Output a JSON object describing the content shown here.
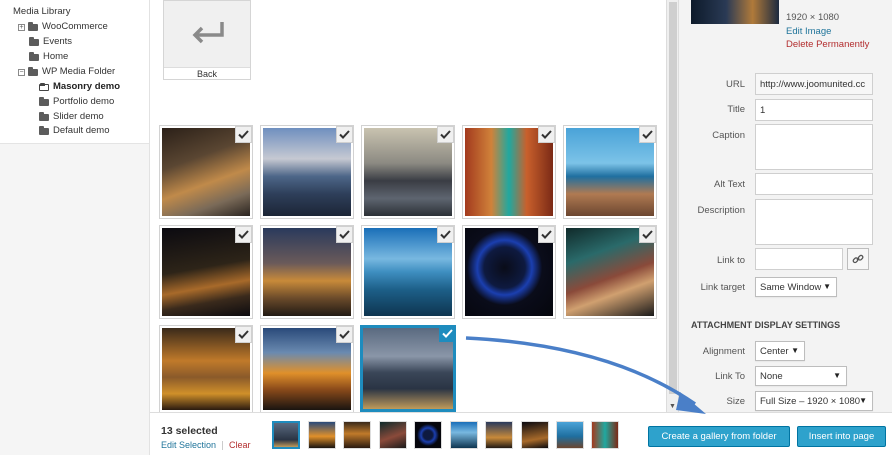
{
  "sidebar": {
    "items": [
      {
        "label": "Media Library",
        "level": 0,
        "expander": "",
        "icon": "none"
      },
      {
        "label": "WooCommerce",
        "level": 1,
        "expander": "+",
        "icon": "folder"
      },
      {
        "label": "Events",
        "level": 1,
        "expander": "",
        "icon": "folder"
      },
      {
        "label": "Home",
        "level": 1,
        "expander": "",
        "icon": "folder"
      },
      {
        "label": "WP Media Folder",
        "level": 1,
        "expander": "−",
        "icon": "folder"
      },
      {
        "label": "Masonry demo",
        "level": 2,
        "expander": "",
        "icon": "folder-open",
        "active": true
      },
      {
        "label": "Portfolio demo",
        "level": 2,
        "expander": "",
        "icon": "folder"
      },
      {
        "label": "Slider demo",
        "level": 2,
        "expander": "",
        "icon": "folder"
      },
      {
        "label": "Default demo",
        "level": 2,
        "expander": "",
        "icon": "folder"
      }
    ]
  },
  "grid": {
    "back_label": "Back",
    "back_icon": "return-arrow-icon",
    "thumbs": [
      {
        "name": "night-street",
        "checked": true
      },
      {
        "name": "city-skyline",
        "checked": true
      },
      {
        "name": "london-bridge",
        "checked": true
      },
      {
        "name": "venice-canal",
        "checked": true
      },
      {
        "name": "wooden-pier",
        "checked": true
      },
      {
        "name": "night-coast",
        "checked": true
      },
      {
        "name": "paris-night",
        "checked": true
      },
      {
        "name": "lake-pier",
        "checked": true
      },
      {
        "name": "ferris-wheel",
        "checked": true
      },
      {
        "name": "street-bokeh",
        "checked": true
      },
      {
        "name": "city-lights",
        "checked": true
      },
      {
        "name": "sunset-skyline",
        "checked": true
      },
      {
        "name": "brooklyn-bridge",
        "checked": true,
        "selected": true
      }
    ]
  },
  "details": {
    "dimensions": "1920 × 1080",
    "edit_image": "Edit Image",
    "delete_permanently": "Delete Permanently",
    "fields": {
      "url_label": "URL",
      "url_value": "http://www.joomunited.cc",
      "title_label": "Title",
      "title_value": "1",
      "caption_label": "Caption",
      "alt_label": "Alt Text",
      "description_label": "Description",
      "link_to_label": "Link to",
      "link_target_label": "Link target",
      "link_target_value": "Same Window"
    },
    "display_settings": {
      "heading": "ATTACHMENT DISPLAY SETTINGS",
      "alignment_label": "Alignment",
      "alignment_value": "Center",
      "link_to_label": "Link To",
      "link_to_value": "None",
      "size_label": "Size",
      "size_value": "Full Size – 1920 × 1080"
    }
  },
  "toolbar": {
    "selected_count": "13 selected",
    "edit_selection": "Edit Selection",
    "clear": "Clear",
    "gallery_button": "Create a gallery from folder",
    "insert_button": "Insert into page"
  },
  "colors": {
    "accent": "#1e8cbe",
    "button": "#2ea2cc",
    "link": "#21759b",
    "danger": "#b32d2e",
    "annotation_arrow": "#4a7fc8"
  }
}
